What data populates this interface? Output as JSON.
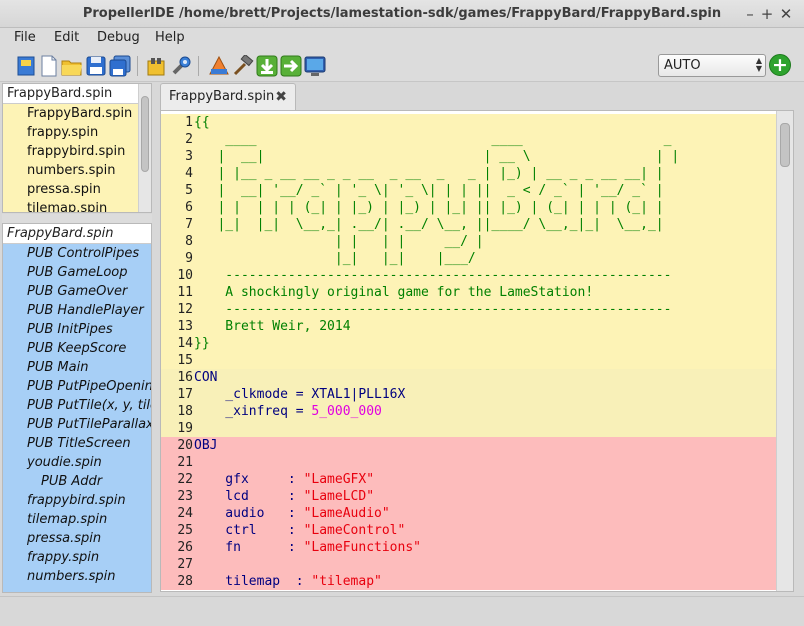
{
  "window": {
    "title": "PropellerIDE /home/brett/Projects/lamestation-sdk/games/FrappyBard/FrappyBard.spin",
    "minimize": "–",
    "maximize": "+",
    "close": "✕"
  },
  "menu": {
    "file": "File",
    "edit": "Edit",
    "debug": "Debug",
    "help": "Help"
  },
  "toolbar": {
    "icons": [
      "select-icon",
      "new-file-icon",
      "open-folder-icon",
      "save-icon",
      "save-all-icon",
      "find-icon",
      "preferences-icon",
      "memory-map-icon",
      "build-icon",
      "download-ram-icon",
      "download-eeprom-icon",
      "terminal-icon"
    ],
    "port_select": "AUTO",
    "add_button": "+"
  },
  "colors": {
    "file_list_bg": "#fdf3b6",
    "outline_bg": "#a7cff6",
    "block_dat": "#fdf3b6",
    "block_con": "#f8f0b8",
    "block_obj": "#fdbcbc",
    "keyword": "#000080",
    "comment": "#008000",
    "string": "#e8000e",
    "number": "#e000e0",
    "plain": "#000080"
  },
  "file_list": {
    "header": "FrappyBard.spin",
    "items": [
      "FrappyBard.spin",
      "frappy.spin",
      "frappybird.spin",
      "numbers.spin",
      "pressa.spin",
      "tilemap.spin"
    ]
  },
  "outline": {
    "header": "FrappyBard.spin",
    "items": [
      {
        "text": "PUB ControlPipes",
        "indent": 1
      },
      {
        "text": "PUB GameLoop",
        "indent": 1
      },
      {
        "text": "PUB GameOver",
        "indent": 1
      },
      {
        "text": "PUB HandlePlayer",
        "indent": 1
      },
      {
        "text": "PUB InitPipes",
        "indent": 1
      },
      {
        "text": "PUB KeepScore",
        "indent": 1
      },
      {
        "text": "PUB Main",
        "indent": 1
      },
      {
        "text": "PUB PutPipeOpening",
        "indent": 1
      },
      {
        "text": "PUB PutTile(x, y, tile)",
        "indent": 1
      },
      {
        "text": "PUB PutTileParallax",
        "indent": 1
      },
      {
        "text": "PUB TitleScreen",
        "indent": 1
      },
      {
        "text": "youdie.spin",
        "indent": 1
      },
      {
        "text": "PUB Addr",
        "indent": 2
      },
      {
        "text": "frappybird.spin",
        "indent": 1
      },
      {
        "text": "tilemap.spin",
        "indent": 1
      },
      {
        "text": "pressa.spin",
        "indent": 1
      },
      {
        "text": "frappy.spin",
        "indent": 1
      },
      {
        "text": "numbers.spin",
        "indent": 1
      }
    ]
  },
  "editor": {
    "tab_label": "FrappyBard.spin",
    "tab_close": "✖",
    "lines": [
      {
        "n": "1",
        "block": "dat",
        "segs": [
          {
            "t": "{{",
            "c": "comment"
          }
        ]
      },
      {
        "n": "2",
        "block": "dat",
        "segs": [
          {
            "t": "    ____                              ____                  _",
            "c": "comment"
          }
        ]
      },
      {
        "n": "3",
        "block": "dat",
        "segs": [
          {
            "t": "   |  __|                            | __ \\                | |",
            "c": "comment"
          }
        ]
      },
      {
        "n": "4",
        "block": "dat",
        "segs": [
          {
            "t": "   | |__ _ __ __ _ _ __  _ __  _   _ | |_) | __ _ _ __ __| |",
            "c": "comment"
          }
        ]
      },
      {
        "n": "5",
        "block": "dat",
        "segs": [
          {
            "t": "   |  __| '__/ _` | '_ \\| '_ \\| | | ||  _ < / _` | '__/ _` |",
            "c": "comment"
          }
        ]
      },
      {
        "n": "6",
        "block": "dat",
        "segs": [
          {
            "t": "   | |  | | | (_| | |_) | |_) | |_| || |_) | (_| | | | (_| |",
            "c": "comment"
          }
        ]
      },
      {
        "n": "7",
        "block": "dat",
        "segs": [
          {
            "t": "   |_|  |_|  \\__,_| .__/| .__/ \\__, ||____/ \\__,_|_|  \\__,_|",
            "c": "comment"
          }
        ]
      },
      {
        "n": "8",
        "block": "dat",
        "segs": [
          {
            "t": "                  | |   | |     __/ |",
            "c": "comment"
          }
        ]
      },
      {
        "n": "9",
        "block": "dat",
        "segs": [
          {
            "t": "                  |_|   |_|    |___/",
            "c": "comment"
          }
        ]
      },
      {
        "n": "10",
        "block": "dat",
        "segs": [
          {
            "t": "    ---------------------------------------------------------",
            "c": "comment"
          }
        ]
      },
      {
        "n": "11",
        "block": "dat",
        "segs": [
          {
            "t": "    A shockingly original game for the LameStation!",
            "c": "comment"
          }
        ]
      },
      {
        "n": "12",
        "block": "dat",
        "segs": [
          {
            "t": "    ---------------------------------------------------------",
            "c": "comment"
          }
        ]
      },
      {
        "n": "13",
        "block": "dat",
        "segs": [
          {
            "t": "    Brett Weir, 2014",
            "c": "comment"
          }
        ]
      },
      {
        "n": "14",
        "block": "dat",
        "segs": [
          {
            "t": "}}",
            "c": "comment"
          }
        ]
      },
      {
        "n": "15",
        "block": "dat",
        "segs": [
          {
            "t": "",
            "c": "plain"
          }
        ]
      },
      {
        "n": "16",
        "block": "con",
        "segs": [
          {
            "t": "CON",
            "c": "keyword"
          }
        ]
      },
      {
        "n": "17",
        "block": "con",
        "segs": [
          {
            "t": "    _clkmode = XTAL1|PLL16X",
            "c": "plain"
          }
        ]
      },
      {
        "n": "18",
        "block": "con",
        "segs": [
          {
            "t": "    _xinfreq = ",
            "c": "plain"
          },
          {
            "t": "5_000_000",
            "c": "number"
          }
        ]
      },
      {
        "n": "19",
        "block": "con",
        "segs": [
          {
            "t": "",
            "c": "plain"
          }
        ]
      },
      {
        "n": "20",
        "block": "obj",
        "segs": [
          {
            "t": "OBJ",
            "c": "keyword"
          }
        ]
      },
      {
        "n": "21",
        "block": "obj",
        "segs": [
          {
            "t": "",
            "c": "plain"
          }
        ]
      },
      {
        "n": "22",
        "block": "obj",
        "segs": [
          {
            "t": "    gfx     : ",
            "c": "plain"
          },
          {
            "t": "\"LameGFX\"",
            "c": "string"
          }
        ]
      },
      {
        "n": "23",
        "block": "obj",
        "segs": [
          {
            "t": "    lcd     : ",
            "c": "plain"
          },
          {
            "t": "\"LameLCD\"",
            "c": "string"
          }
        ]
      },
      {
        "n": "24",
        "block": "obj",
        "segs": [
          {
            "t": "    audio   : ",
            "c": "plain"
          },
          {
            "t": "\"LameAudio\"",
            "c": "string"
          }
        ]
      },
      {
        "n": "25",
        "block": "obj",
        "segs": [
          {
            "t": "    ctrl    : ",
            "c": "plain"
          },
          {
            "t": "\"LameControl\"",
            "c": "string"
          }
        ]
      },
      {
        "n": "26",
        "block": "obj",
        "segs": [
          {
            "t": "    fn      : ",
            "c": "plain"
          },
          {
            "t": "\"LameFunctions\"",
            "c": "string"
          }
        ]
      },
      {
        "n": "27",
        "block": "obj",
        "segs": [
          {
            "t": "",
            "c": "plain"
          }
        ]
      },
      {
        "n": "28",
        "block": "obj",
        "segs": [
          {
            "t": "    tilemap  : ",
            "c": "plain"
          },
          {
            "t": "\"tilemap\"",
            "c": "string"
          }
        ]
      }
    ]
  },
  "status": {
    "text": ""
  }
}
